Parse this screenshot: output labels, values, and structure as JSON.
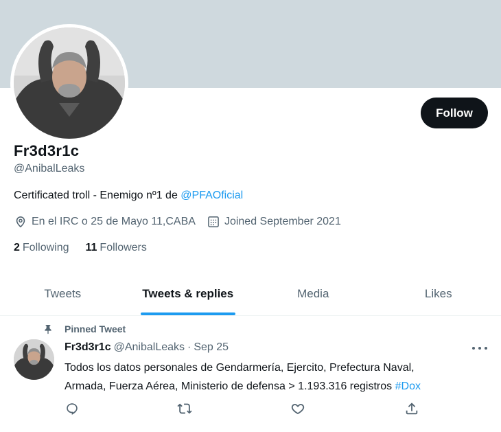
{
  "profile": {
    "display_name": "Fr3d3r1c",
    "handle": "@AnibalLeaks",
    "follow_label": "Follow",
    "bio_text": "Certificated troll - Enemigo nº1 de ",
    "bio_mention": "@PFAOficial",
    "location": "En el IRC o 25 de Mayo 11,CABA",
    "joined": "Joined September 2021",
    "following_count": "2",
    "following_label": "Following",
    "followers_count": "11",
    "followers_label": "Followers",
    "banner_color": "#cfd9de"
  },
  "tabs": [
    {
      "label": "Tweets",
      "active": false
    },
    {
      "label": "Tweets & replies",
      "active": true
    },
    {
      "label": "Media",
      "active": false
    },
    {
      "label": "Likes",
      "active": false
    }
  ],
  "pinned_tweet": {
    "pinned_label": "Pinned Tweet",
    "author_name": "Fr3d3r1c",
    "author_handle": "@AnibalLeaks",
    "separator": "·",
    "date": "Sep 25",
    "text_line1": "Todos los datos personales de Gendarmería, Ejercito, Prefectura Naval,",
    "text_line2": "Armada, Fuerza Aérea, Ministerio de defensa > 1.193.316 registros ",
    "hashtag": "#Dox"
  },
  "icons": {
    "location": "location-pin-icon",
    "calendar": "calendar-icon",
    "pin": "pin-icon",
    "more": "more-dots-icon",
    "reply": "reply-icon",
    "retweet": "retweet-icon",
    "like": "heart-icon",
    "share": "share-icon"
  },
  "colors": {
    "accent": "#1d9bf0",
    "text_primary": "#0f1419",
    "text_secondary": "#536471",
    "follow_button_bg": "#0f1419"
  }
}
